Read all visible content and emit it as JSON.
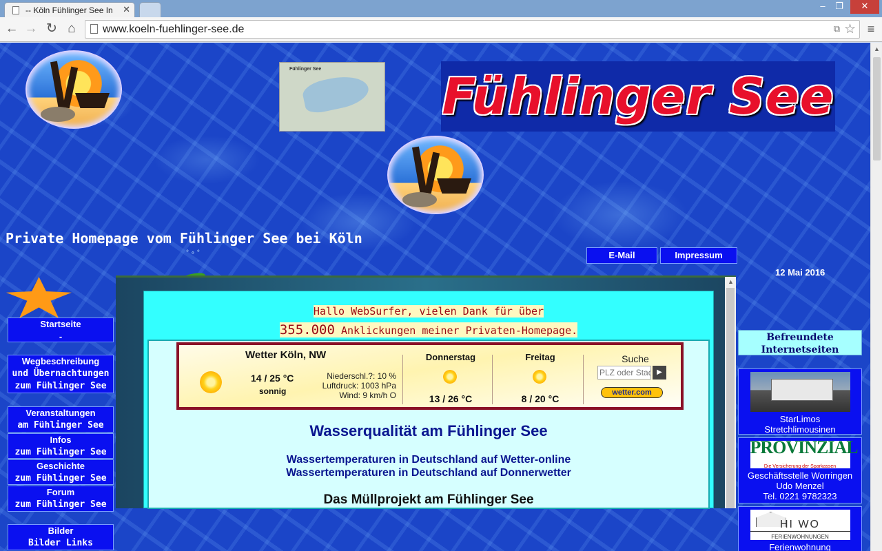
{
  "browser": {
    "tab_title": "-- Köln Fühlinger See In",
    "url": "www.koeln-fuehlinger-see.de",
    "window_controls": {
      "minimize": "–",
      "maximize": "❐",
      "close": "✕"
    },
    "icons": [
      "back-icon",
      "forward-icon",
      "reload-icon",
      "home-icon",
      "page-icon",
      "translate-icon",
      "star-icon",
      "menu-icon"
    ]
  },
  "header": {
    "banner_title": "Fühlinger See",
    "map_caption": "Fühlinger See",
    "subtitle": "Private Homepage vom Fühlinger See bei Köln",
    "email_label": "E-Mail",
    "impressum_label": "Impressum",
    "date": "12 Mai 2016"
  },
  "left_nav": {
    "start": {
      "line1": "Startseite",
      "line2": "-"
    },
    "wegbeschreibung": {
      "line1": "Wegbeschreibung",
      "line2": "und Übernachtungen",
      "line3": "zum Fühlinger See"
    },
    "veranstaltungen": {
      "line1": "Veranstaltungen",
      "line2": "am Fühlinger See"
    },
    "infos": {
      "line1": "Infos",
      "line2": "zum Fühlinger See"
    },
    "geschichte": {
      "line1": "Geschichte",
      "line2": "zum Fühlinger See"
    },
    "forum": {
      "line1": "Forum",
      "line2": "zum Fühlinger See"
    },
    "bilder": {
      "line1": "Bilder",
      "line2": "Bilder Links"
    }
  },
  "content": {
    "hello_line1": "Hallo WebSurfer, vielen Dank für über",
    "hello_count": "355.000",
    "hello_line2_rest": " Anklickungen meiner Privaten-Homepage.",
    "weather": {
      "title": "Wetter Köln, NW",
      "today_temp": "14 / 25 °C",
      "today_condition": "sonnig",
      "precipitation": "Niederschl.?: 10 %",
      "pressure": "Luftdruck: 1003 hPa",
      "wind": "Wind: 9 km/h O",
      "day1_name": "Donnerstag",
      "day1_temp": "13 / 26 °C",
      "day2_name": "Freitag",
      "day2_temp": "8 / 20 °C",
      "search_label": "Suche",
      "search_placeholder": "PLZ oder Stadt",
      "search_button": "▶",
      "brand": "wetter.com"
    },
    "water_quality_title": "Wasserqualität am Fühlinger See",
    "link_wetter_online": "Wassertemperaturen in Deutschland auf  Wetter-online",
    "link_donnerwetter": "Wassertemperaturen in Deutschland auf Donnerwetter",
    "muell_title": "Das Müllprojekt am Fühlinger See"
  },
  "right_column": {
    "header_line1": "Befreundete",
    "header_line2": "Internetseiten",
    "starlimos": {
      "line1": "StarLimos",
      "line2": "Stretchlimousinen"
    },
    "provinzial": {
      "logo_text": "PROVINZIAL",
      "logo_sub": "Die Versicherung der Sparkassen",
      "line1": "Geschäftsstelle Worringen",
      "line2": "Udo Menzel",
      "line3": "Tel. 0221 9782323"
    },
    "hiwo": {
      "logo_text": "HI WO",
      "logo_sub": "FERIENWOHNUNGEN",
      "line1": "Ferienwohnung"
    }
  }
}
